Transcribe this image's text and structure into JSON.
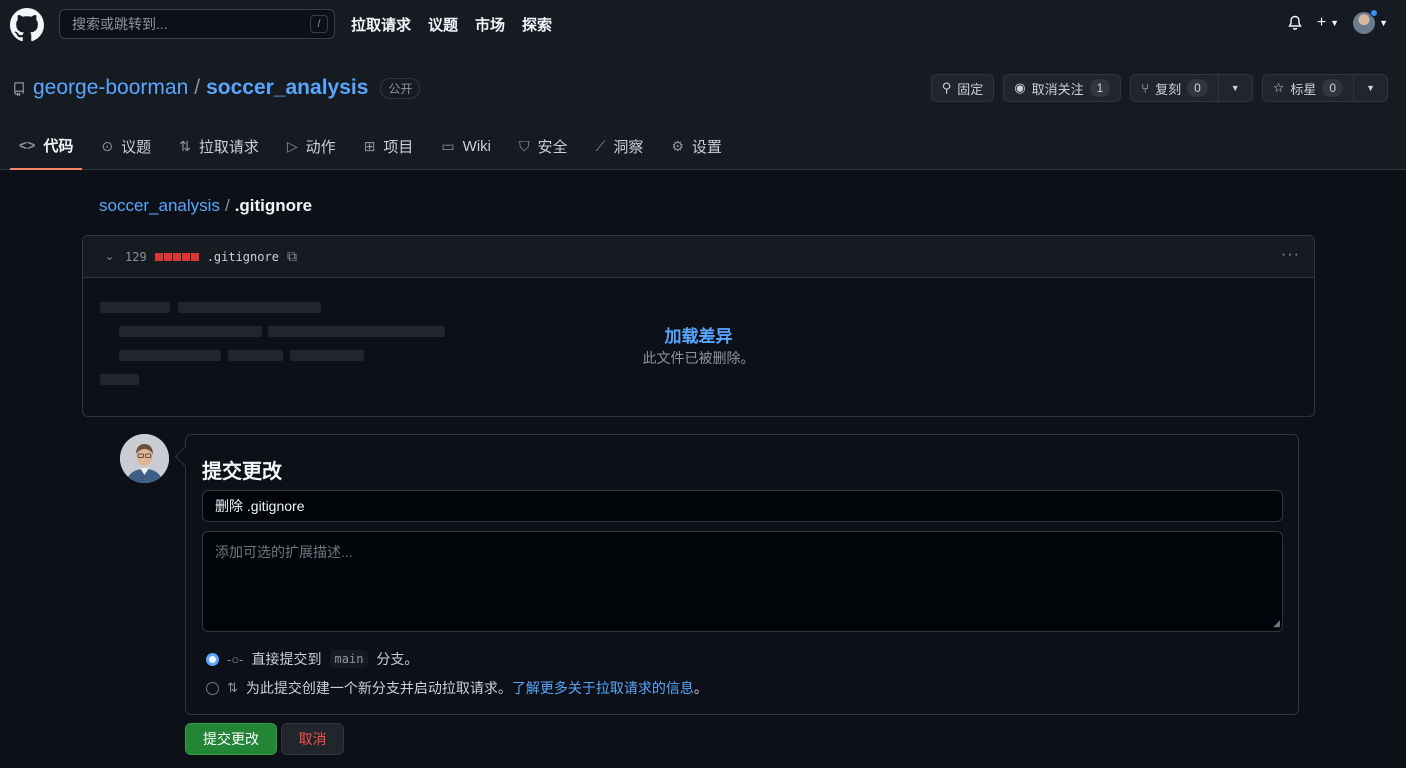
{
  "colors": {
    "background": "#0d1117",
    "header": "#161b22",
    "accent_link": "#58a6ff",
    "danger": "#f85149",
    "primary_button": "#238636",
    "tab_underline": "#f78166"
  },
  "header": {
    "search_placeholder": "搜索或跳转到...",
    "search_shortcut": "/",
    "nav": [
      "拉取请求",
      "议题",
      "市场",
      "探索"
    ],
    "icons": [
      "github-logo-icon",
      "bell-icon",
      "plus-icon",
      "avatar"
    ]
  },
  "repo": {
    "owner": "george-boorman",
    "separator": "/",
    "name": "soccer_analysis",
    "visibility": "公开",
    "actions": {
      "pin": "固定",
      "unwatch": "取消关注",
      "unwatch_count": "1",
      "fork": "复刻",
      "fork_count": "0",
      "star": "标星",
      "star_count": "0"
    },
    "tabs": [
      {
        "label": "代码",
        "icon": "code-icon"
      },
      {
        "label": "议题",
        "icon": "issue-icon"
      },
      {
        "label": "拉取请求",
        "icon": "pull-request-icon"
      },
      {
        "label": "动作",
        "icon": "play-icon"
      },
      {
        "label": "项目",
        "icon": "table-icon"
      },
      {
        "label": "Wiki",
        "icon": "book-icon"
      },
      {
        "label": "安全",
        "icon": "shield-icon"
      },
      {
        "label": "洞察",
        "icon": "graph-icon"
      },
      {
        "label": "设置",
        "icon": "gear-icon"
      }
    ]
  },
  "breadcrumb": {
    "repo": "soccer_analysis",
    "separator": "/",
    "file": ".gitignore"
  },
  "diff": {
    "deletions": "129",
    "file": ".gitignore",
    "load_link": "加载差异",
    "message": "此文件已被删除。"
  },
  "commit": {
    "title": "提交更改",
    "message_value": "删除 .gitignore",
    "description_placeholder": "添加可选的扩展描述...",
    "option_direct_prefix": "直接提交到",
    "option_direct_branch": "main",
    "option_direct_suffix": "分支。",
    "option_branch_text": "为此提交创建一个新分支并启动拉取请求。",
    "option_branch_link": "了解更多关于拉取请求的信息",
    "option_branch_end": "。",
    "submit": "提交更改",
    "cancel": "取消"
  }
}
